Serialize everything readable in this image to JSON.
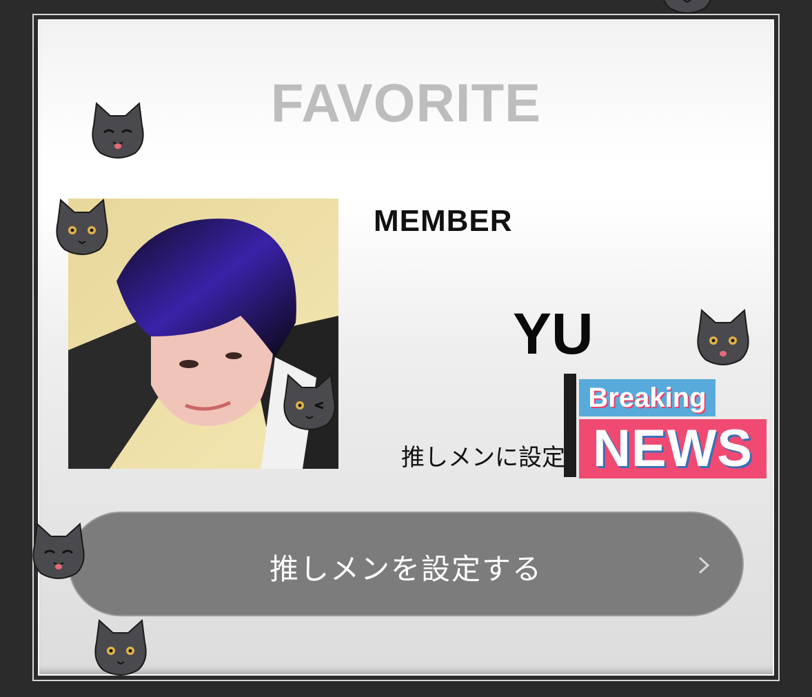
{
  "card": {
    "title": "FAVORITE",
    "member_label": "MEMBER",
    "member_name": "YU",
    "set_oshi_link": "推しメンに設定",
    "main_button_label": "推しメンを設定する"
  },
  "sticker": {
    "line1": "Breaking",
    "line2": "NEWS"
  },
  "icons": {
    "button_arrow": "chevron-right-icon",
    "cat_stickers": [
      "cat-happy-icon",
      "cat-neutral-icon",
      "cat-wink-icon",
      "cat-smile-icon"
    ]
  },
  "colors": {
    "page_background": "#2b2b2b",
    "title": "#bdbdbd",
    "button": "#7c7c7c",
    "breaking_blue": "#58aadb",
    "news_pink": "#f04a73"
  }
}
